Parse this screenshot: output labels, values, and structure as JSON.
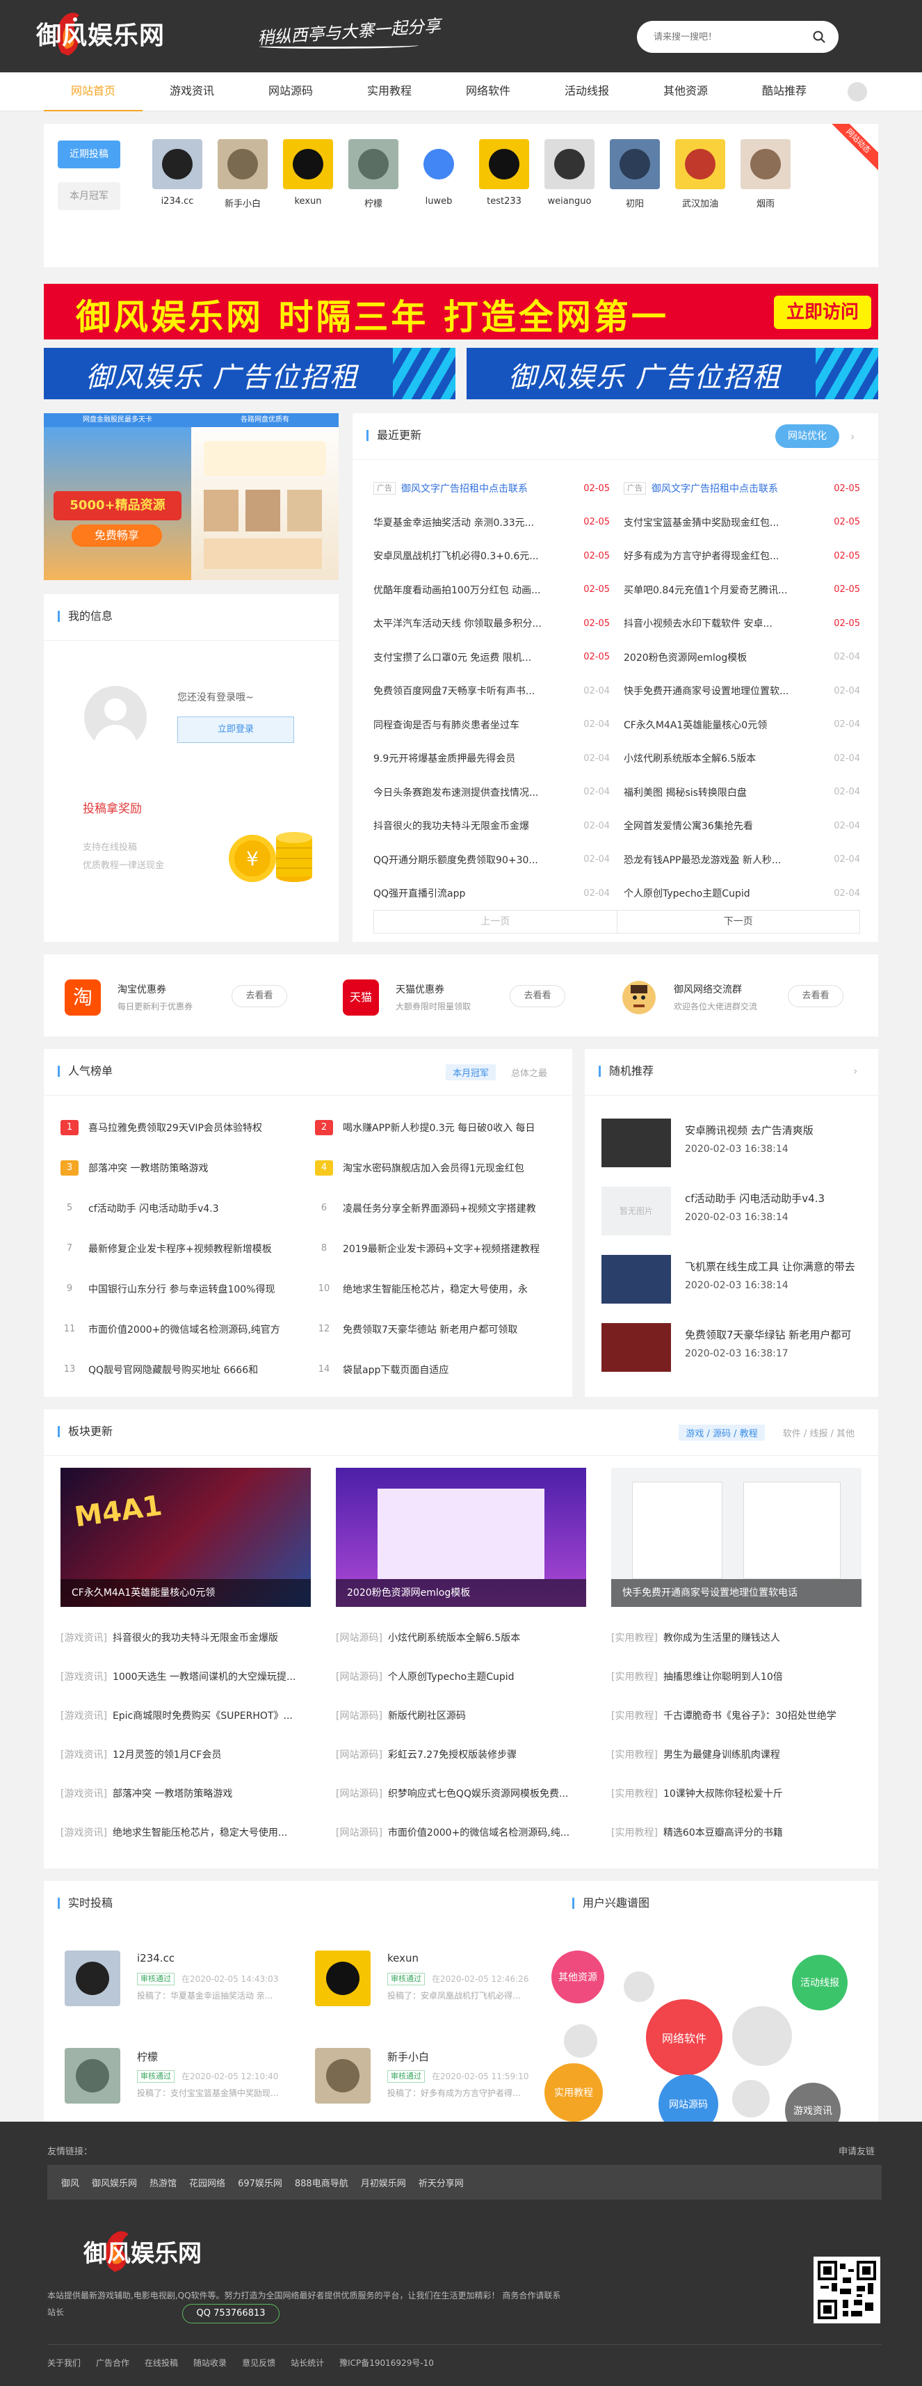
{
  "header": {
    "logo_text": "御风娱乐网",
    "slogan": "稍纵西亭与大寨一起分享",
    "search_placeholder": "请来搜一搜吧！"
  },
  "nav": [
    "网站首页",
    "游戏资讯",
    "网站源码",
    "实用教程",
    "网络软件",
    "活动线报",
    "其他资源",
    "酷站推荐"
  ],
  "users_strip": {
    "tabs": [
      "近期投稿",
      "本月冠军"
    ],
    "corner": "网站动态",
    "users": [
      "i234.cc",
      "新手小白",
      "kexun",
      "柠檬",
      "luweb",
      "test233",
      "weianguo",
      "初阳",
      "武汉加油",
      "烟雨"
    ]
  },
  "banner_big": {
    "title": "御风娱乐网  时隔三年 打造全网第一",
    "button": "立即访问"
  },
  "ads": [
    "御风娱乐  广告位招租",
    "御风娱乐  广告位招租"
  ],
  "promo": {
    "header_left": "网盘金融股民最多天卡",
    "header_right": "各路网盘优质有",
    "big": "5000+精品资源",
    "badge": "免费畅享"
  },
  "my_info": {
    "title": "我的信息",
    "not_logged": "您还没有登录哦~",
    "login_btn": "立即登录",
    "reward": "投稿拿奖励",
    "support": [
      "支持在线投稿",
      "优质教程一律送现金"
    ]
  },
  "latest": {
    "title": "最近更新",
    "opt_btn": "网站优化",
    "left": [
      {
        "tag": "广告",
        "title": "御风文字广告招租中点击联系",
        "date": "02-05",
        "ad": true
      },
      {
        "title": "华夏基金幸运抽奖活动 亲测0.33元...",
        "date": "02-05"
      },
      {
        "title": "安卓凤凰战机打飞机必得0.3+0.6元...",
        "date": "02-05"
      },
      {
        "title": "优酷年度看动画拍100万分红包 动画...",
        "date": "02-05"
      },
      {
        "title": "太平洋汽车活动天线 你领取最多积分...",
        "date": "02-05"
      },
      {
        "title": "支付宝攒了么口罩0元 免运费 限机...",
        "date": "02-05"
      },
      {
        "title": "免费领百度网盘7天畅享卡听有声书...",
        "date": "02-04"
      },
      {
        "title": "同程查询是否与有肺炎患者坐过车",
        "date": "02-04"
      },
      {
        "title": "9.9元开将爆基金质押最先得会员",
        "date": "02-04"
      },
      {
        "title": "今日头条赛跑发布速测提供查找情况...",
        "date": "02-04"
      },
      {
        "title": "抖音很火的我功夫特斗无限金币金爆",
        "date": "02-04"
      },
      {
        "title": "QQ开通分期乐额度免费领取90+30...",
        "date": "02-04"
      },
      {
        "title": "QQ强开直播引流app",
        "date": "02-04"
      }
    ],
    "right": [
      {
        "tag": "广告",
        "title": "御风文字广告招租中点击联系",
        "date": "02-05",
        "ad": true
      },
      {
        "title": "支付宝宝篮基金猜中奖励现金红包...",
        "date": "02-05"
      },
      {
        "title": "好多有成为方言守护者得现金红包...",
        "date": "02-05"
      },
      {
        "title": "买单吧0.84元充值1个月爱奇艺腾讯...",
        "date": "02-05"
      },
      {
        "title": "抖音小视频去水印下载软件 安卓...",
        "date": "02-05"
      },
      {
        "title": "2020粉色资源网emlog模板",
        "date": "02-04"
      },
      {
        "title": "快手免费开通商家号设置地理位置软...",
        "date": "02-04"
      },
      {
        "title": "CF永久M4A1英雄能量核心0元领",
        "date": "02-04"
      },
      {
        "title": "小炫代刷系统版本全解6.5版本",
        "date": "02-04"
      },
      {
        "title": "福利美图 揭秘sis转换限白盘",
        "date": "02-04"
      },
      {
        "title": "全网首发爱情公寓36集抢先看",
        "date": "02-04"
      },
      {
        "title": "恐龙有钱APP最恐龙游戏盈 新人秒...",
        "date": "02-04"
      },
      {
        "title": "个人原创Typecho主题Cupid",
        "date": "02-04"
      }
    ],
    "pager": [
      "上一页",
      "下一页"
    ]
  },
  "coupons": [
    {
      "name": "淘宝优惠券",
      "desc": "每日更新利于优惠券",
      "btn": "去看看",
      "icon": "淘"
    },
    {
      "name": "天猫优惠券",
      "desc": "大额券限时限量领取",
      "btn": "去看看",
      "icon": "天猫"
    },
    {
      "name": "御风网络交流群",
      "desc": "欢迎各位大佬进群交流",
      "btn": "去看看",
      "icon": ""
    }
  ],
  "popular": {
    "title": "人气榜单",
    "tabs": [
      "本月冠军",
      "总体之最"
    ],
    "items": [
      "喜马拉雅免费领取29天VIP会员体验特权",
      "喝水赚APP新人秒提0.3元 每日破0收入 每日",
      "部落冲突 一教塔防策略游戏",
      "淘宝水密码旗舰店加入会员得1元现金红包",
      "cf活动助手 闪电活动助手v4.3",
      "凌晨任务分享全新界面源码+视频文字搭建教",
      "最新修复企业发卡程序+视频教程新增模板",
      "2019最新企业发卡源码+文字+视频搭建教程",
      "中国银行山东分行 参与幸运转盘100%得现",
      "绝地求生智能压枪芯片，稳定大号使用，永",
      "市面价值2000+的微信域名检测源码,纯官方",
      "免费领取7天豪华德站 新老用户都可领取",
      "QQ靓号官网隐藏靓号购买地址 6666和",
      "袋鼠app下载页面自适应"
    ]
  },
  "random": {
    "title": "随机推荐",
    "items": [
      {
        "title": "安卓腾讯视频 去广告清爽版",
        "date": "2020-02-03 16:38:14",
        "img": ""
      },
      {
        "title": "cf活动助手 闪电活动助手v4.3",
        "date": "2020-02-03 16:38:14",
        "img": "暂无图片"
      },
      {
        "title": "飞机票在线生成工具 让你满意的带去",
        "date": "2020-02-03 16:38:14",
        "img": ""
      },
      {
        "title": "免费领取7天豪华绿钻 新老用户都可",
        "date": "2020-02-03 16:38:17",
        "img": ""
      }
    ]
  },
  "block": {
    "title": "板块更新",
    "tabs": [
      "游戏 / 源码 / 教程",
      "软件 / 线报 / 其他"
    ],
    "cards": [
      "CF永久M4A1英雄能量核心0元领",
      "2020粉色资源网emlog模板",
      "快手免费开通商家号设置地理位置软电话"
    ],
    "columns": [
      [
        {
          "c": "[游戏资讯]",
          "t": "抖音很火的我功夫特斗无限金币金爆版"
        },
        {
          "c": "[游戏资讯]",
          "t": "1000天选生 一教塔间谍机的大空燥玩提..."
        },
        {
          "c": "[游戏资讯]",
          "t": "Epic商城限时免费购买《SUPERHOT》..."
        },
        {
          "c": "[游戏资讯]",
          "t": "12月灵签的领1月CF会员"
        },
        {
          "c": "[游戏资讯]",
          "t": "部落冲突 一教塔防策略游戏"
        },
        {
          "c": "[游戏资讯]",
          "t": "绝地求生智能压枪芯片，稳定大号使用..."
        }
      ],
      [
        {
          "c": "[网站源码]",
          "t": "小炫代刷系统版本全解6.5版本"
        },
        {
          "c": "[网站源码]",
          "t": "个人原创Typecho主题Cupid"
        },
        {
          "c": "[网站源码]",
          "t": "新版代刷社区源码"
        },
        {
          "c": "[网站源码]",
          "t": "彩虹云7.27免授权版装修步骤"
        },
        {
          "c": "[网站源码]",
          "t": "织梦响应式七色QQ娱乐资源网模板免费..."
        },
        {
          "c": "[网站源码]",
          "t": "市面价值2000+的微信域名检测源码,纯..."
        }
      ],
      [
        {
          "c": "[实用教程]",
          "t": "教你成为生活里的赚钱达人"
        },
        {
          "c": "[实用教程]",
          "t": "抽搐思维让你聪明到人10倍"
        },
        {
          "c": "[实用教程]",
          "t": "千古谭脆奇书《鬼谷子》：30招处世绝学"
        },
        {
          "c": "[实用教程]",
          "t": "男生为最健身训练肌肉课程"
        },
        {
          "c": "[实用教程]",
          "t": "10课钟大叔陈你轻松爱十斤"
        },
        {
          "c": "[实用教程]",
          "t": "精选60本豆瓣高评分的书籍"
        }
      ]
    ]
  },
  "realtime": {
    "title": "实时投稿",
    "items": [
      {
        "name": "i234.cc",
        "status": "审核通过",
        "time": "在2020-02-05 14:43:03",
        "desc": "投稿了：华夏基金幸运抽奖活动 亲..."
      },
      {
        "name": "kexun",
        "status": "审核通过",
        "time": "在2020-02-05 12:46:26",
        "desc": "投稿了：安卓凤凰战机打飞机必得..."
      },
      {
        "name": "柠檬",
        "status": "审核通过",
        "time": "在2020-02-05 12:10:40",
        "desc": "投稿了：支付宝宝篮基金猜中奖励现..."
      },
      {
        "name": "新手小白",
        "status": "审核通过",
        "time": "在2020-02-05 11:59:10",
        "desc": "投稿了：好多有成为方言守护者得..."
      }
    ]
  },
  "interest": {
    "title": "用户兴趣谱图",
    "tags": [
      "其他资源",
      "活动线报",
      "网络软件",
      "实用教程",
      "网站源码",
      "游戏资讯"
    ],
    "colors": [
      "#f04b7e",
      "#3cc46b",
      "#f1444b",
      "#f5a524",
      "#3b93e8",
      "#777777"
    ]
  },
  "footer": {
    "friend_label": "友情链接：",
    "apply": "申请友链",
    "links": [
      "御风",
      "御风娱乐网",
      "热游馆",
      "花园网络",
      "697娱乐网",
      "888电商导航",
      "月初娱乐网",
      "祈天分享网"
    ],
    "logo_text": "御风娱乐网",
    "desc": "本站提供最新游戏辅助,电影电视剧,QQ软件等。努力打造为全国网络最好者提供优质服务的平台，让我们在生活更加精彩！ 商务合作请联系站长",
    "qq": "QQ 753766813",
    "bottom": [
      "关于我们",
      "广告合作",
      "在线投稿",
      "随站收录",
      "意见反馈",
      "站长统计",
      "豫ICP备19016929号-10"
    ]
  }
}
